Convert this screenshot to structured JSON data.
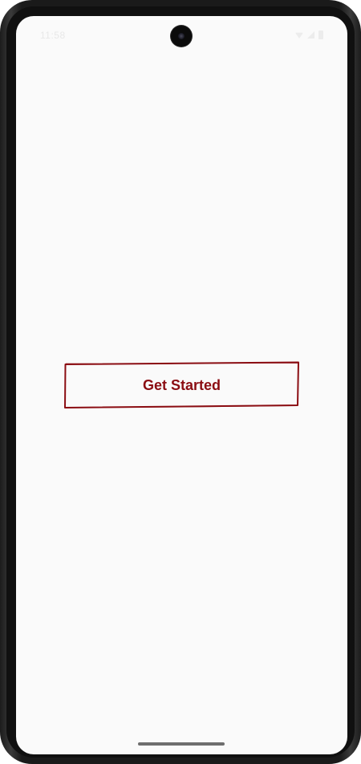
{
  "status_bar": {
    "time": "11:58",
    "icons": [
      "wifi-icon",
      "signal-icon",
      "battery-icon"
    ]
  },
  "main": {
    "get_started_label": "Get Started"
  },
  "colors": {
    "accent": "#8b0d12",
    "screen_background": "#fafafa",
    "device_frame": "#1a1a1a"
  }
}
